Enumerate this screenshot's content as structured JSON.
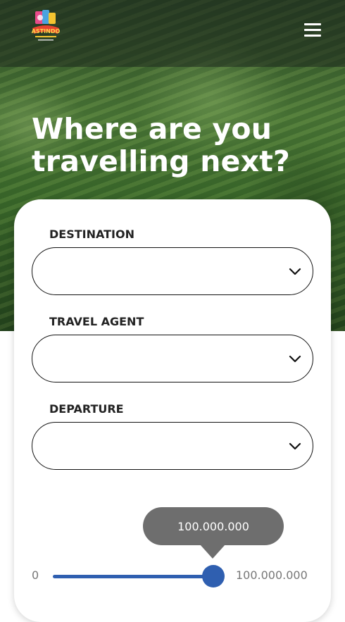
{
  "header": {
    "logo_text": "ASTINDO",
    "menu_icon": "hamburger-menu-icon"
  },
  "hero": {
    "headline": "Where are you travelling next?"
  },
  "form": {
    "fields": [
      {
        "label": "DESTINATION",
        "value": "",
        "icon": "chevron-down-icon"
      },
      {
        "label": "TRAVEL AGENT",
        "value": "",
        "icon": "chevron-down-icon"
      },
      {
        "label": "DEPARTURE",
        "value": "",
        "icon": "chevron-down-icon"
      }
    ],
    "price_slider": {
      "min_label": "0",
      "max_label": "100.000.000",
      "current_value": "100.000.000",
      "fill_fraction": 1.0
    }
  },
  "colors": {
    "accent": "#2f5fb0",
    "tooltip": "#6e6e6e"
  }
}
